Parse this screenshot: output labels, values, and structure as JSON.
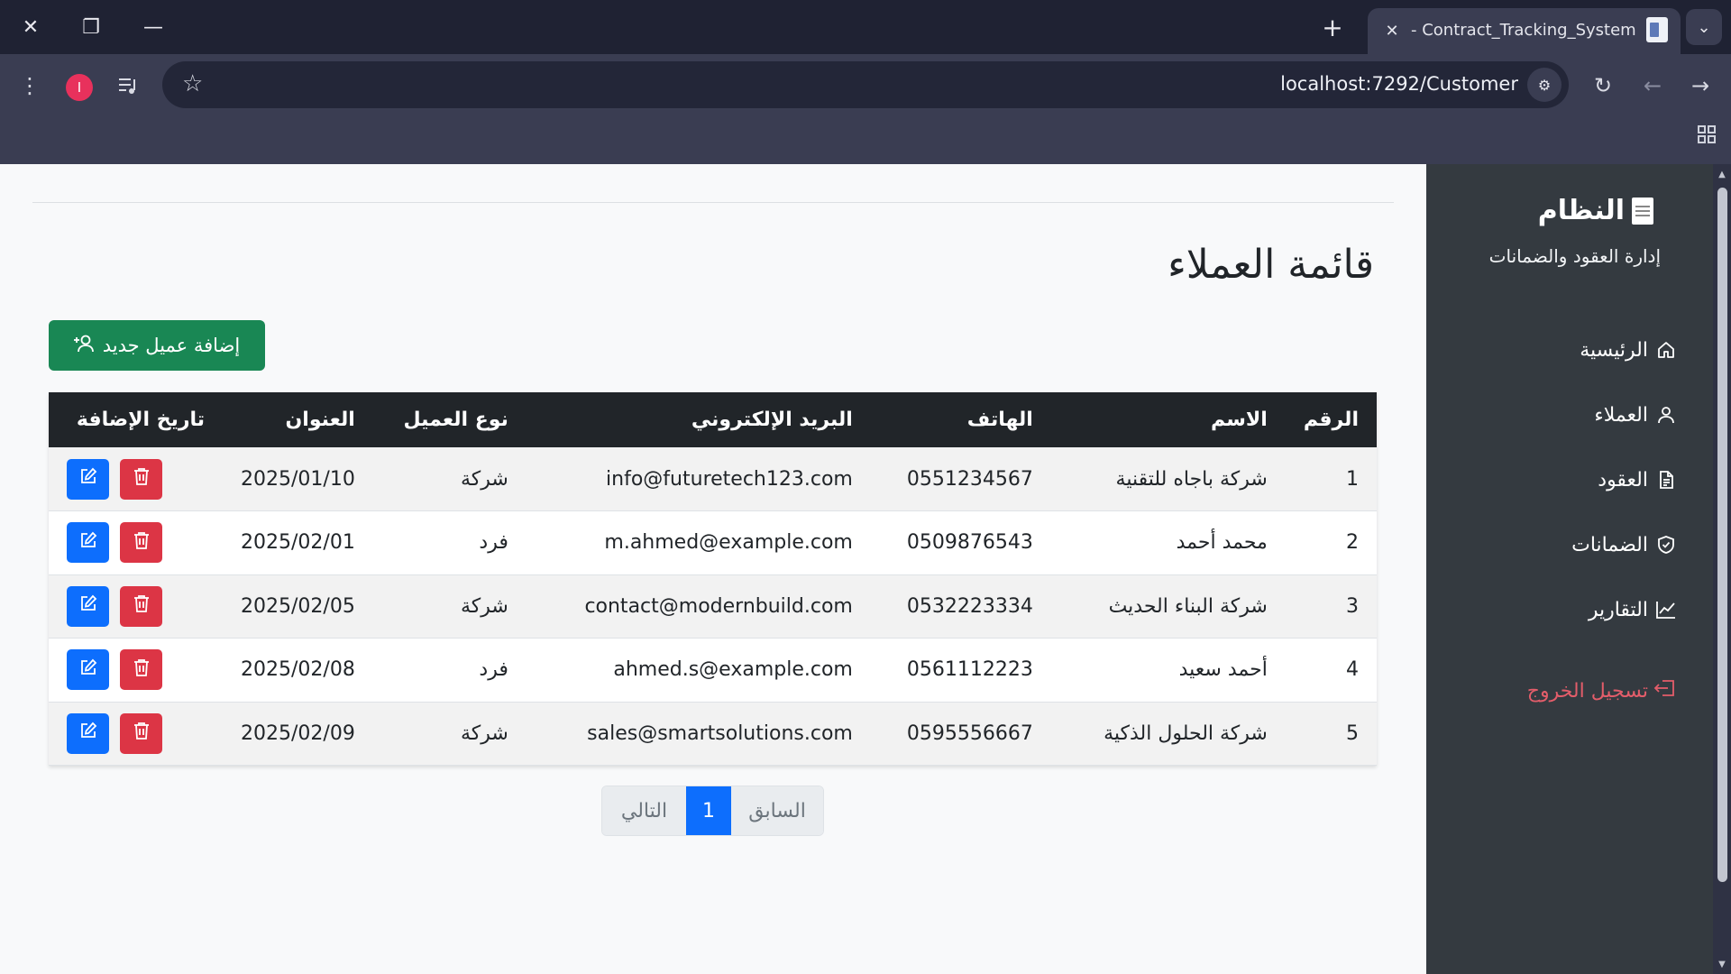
{
  "browser": {
    "tab_title": "- Contract_Tracking_System",
    "profile_initial": "I",
    "url_host": "localhost",
    "url_rest": ":7292/Customer"
  },
  "sidebar": {
    "brand": "النظام",
    "subtitle": "إدارة العقود والضمانات",
    "items": [
      {
        "label": "الرئيسية",
        "icon": "home-icon"
      },
      {
        "label": "العملاء",
        "icon": "person-icon"
      },
      {
        "label": "العقود",
        "icon": "document-icon"
      },
      {
        "label": "الضمانات",
        "icon": "shield-icon"
      },
      {
        "label": "التقارير",
        "icon": "chart-line-icon"
      }
    ],
    "logout": "تسجيل الخروج"
  },
  "main": {
    "title": "قائمة العملاء",
    "add_button": "إضافة عميل جديد",
    "columns": [
      "الرقم",
      "الاسم",
      "الهاتف",
      "البريد الإلكتروني",
      "نوع العميل",
      "العنوان",
      "تاريخ الإضافة"
    ],
    "rows": [
      {
        "num": "1",
        "name": "شركة باجاه للتقنية",
        "phone": "0551234567",
        "email": "info@futuretech123.com",
        "type": "شركة",
        "date": "2025/01/10"
      },
      {
        "num": "2",
        "name": "محمد أحمد",
        "phone": "0509876543",
        "email": "m.ahmed@example.com",
        "type": "فرد",
        "date": "2025/02/01"
      },
      {
        "num": "3",
        "name": "شركة البناء الحديث",
        "phone": "0532223334",
        "email": "contact@modernbuild.com",
        "type": "شركة",
        "date": "2025/02/05"
      },
      {
        "num": "4",
        "name": "أحمد سعيد",
        "phone": "0561112223",
        "email": "ahmed.s@example.com",
        "type": "فرد",
        "date": "2025/02/08"
      },
      {
        "num": "5",
        "name": "شركة الحلول الذكية",
        "phone": "0595556667",
        "email": "sales@smartsolutions.com",
        "type": "شركة",
        "date": "2025/02/09"
      }
    ]
  },
  "pagination": {
    "prev": "السابق",
    "current": "1",
    "next": "التالي"
  },
  "colors": {
    "sidebar_bg": "#343a40",
    "success": "#198754",
    "danger": "#dc3545",
    "primary": "#0d6efd",
    "logout": "#e35d6a"
  }
}
